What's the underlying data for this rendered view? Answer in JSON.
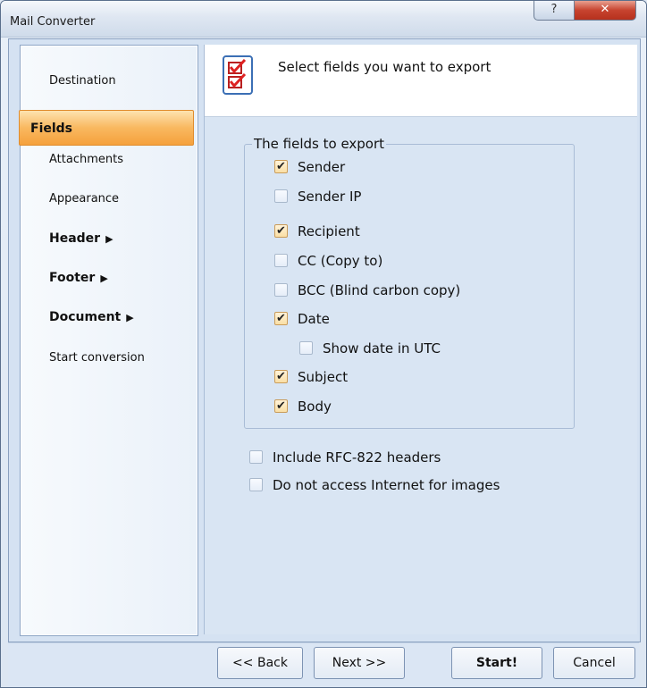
{
  "window": {
    "title": "Mail Converter",
    "help_glyph": "?",
    "close_glyph": "✕"
  },
  "nav": {
    "items": [
      {
        "label": "Destination"
      },
      {
        "label": "Fields"
      },
      {
        "label": "Attachments"
      },
      {
        "label": "Appearance"
      },
      {
        "label": "Header",
        "arrow": "▶"
      },
      {
        "label": "Footer",
        "arrow": "▶"
      },
      {
        "label": "Document",
        "arrow": "▶"
      },
      {
        "label": "Start conversion"
      }
    ]
  },
  "header": {
    "icon": "checklist-icon",
    "text": "Select fields you want to export"
  },
  "fields_group": {
    "legend": "The fields to export",
    "items": [
      {
        "label": "Sender",
        "checked": true
      },
      {
        "label": "Sender IP",
        "checked": false
      },
      {
        "label": "Recipient",
        "checked": true
      },
      {
        "label": "CC (Copy to)",
        "checked": false
      },
      {
        "label": "BCC (Blind carbon copy)",
        "checked": false
      },
      {
        "label": "Date",
        "checked": true
      },
      {
        "label": "Show date in UTC",
        "checked": false
      },
      {
        "label": "Subject",
        "checked": true
      },
      {
        "label": "Body",
        "checked": true
      }
    ]
  },
  "options": [
    {
      "label": "Include RFC-822 headers",
      "checked": false
    },
    {
      "label": "Do not access Internet for images",
      "checked": false
    }
  ],
  "buttons": {
    "back": "<< Back",
    "next": "Next >>",
    "start": "Start!",
    "cancel": "Cancel"
  },
  "colors": {
    "accent": "#f5a13c",
    "title_close": "#c7432f"
  }
}
